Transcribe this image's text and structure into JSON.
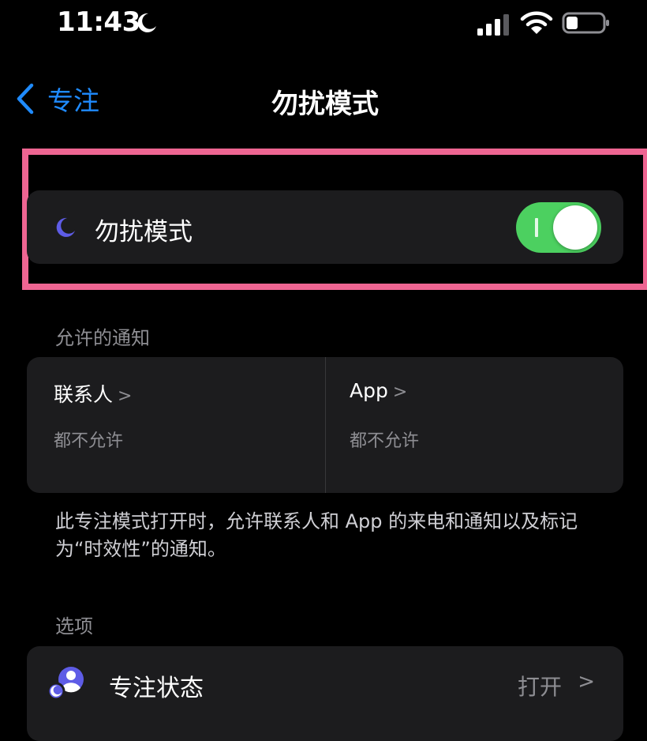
{
  "status_bar": {
    "time": "11:43",
    "icons": [
      "moon-icon",
      "signal-icon",
      "wifi-icon",
      "battery-icon"
    ]
  },
  "nav": {
    "back_label": "专注",
    "title": "勿扰模式"
  },
  "dnd": {
    "label": "勿扰模式",
    "enabled": true
  },
  "allowed_notifications": {
    "header": "允许的通知",
    "people": {
      "title": "联系人",
      "value": "都不允许"
    },
    "apps": {
      "title": "App",
      "value": "都不允许"
    }
  },
  "footnote": "此专注模式打开时，允许联系人和 App 的来电和通知以及标记为“时效性”的通知。",
  "options": {
    "header": "选项",
    "focus_status": {
      "label": "专注状态",
      "value": "打开"
    }
  },
  "colors": {
    "accent_blue": "#1f8bff",
    "toggle_green": "#4cd060",
    "moon_purple": "#5e5ce6",
    "highlight_pink": "#ee6592",
    "cell_background": "#1c1c1e"
  }
}
